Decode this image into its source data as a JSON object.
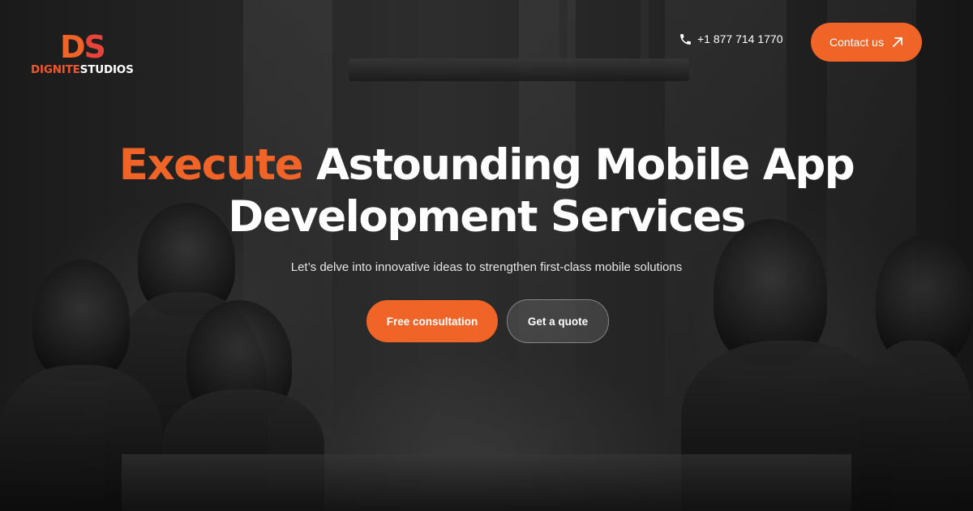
{
  "brand": {
    "mark_d": "D",
    "mark_s": "S",
    "name_part1": "DIGNITE",
    "name_part2": "STUDIOS",
    "accent_color": "#f06427"
  },
  "header": {
    "phone_icon": "phone-icon",
    "phone": "+1 877 714 1770",
    "contact_label": "Contact us",
    "contact_icon": "arrow-up-right-icon"
  },
  "hero": {
    "headline_accent": "Execute",
    "headline_line1_rest": " Astounding Mobile App",
    "headline_line2": "Development Services",
    "subtitle": "Let’s delve into innovative ideas to strengthen first-class mobile solutions",
    "primary_cta": "Free consultation",
    "secondary_cta": "Get a quote"
  }
}
